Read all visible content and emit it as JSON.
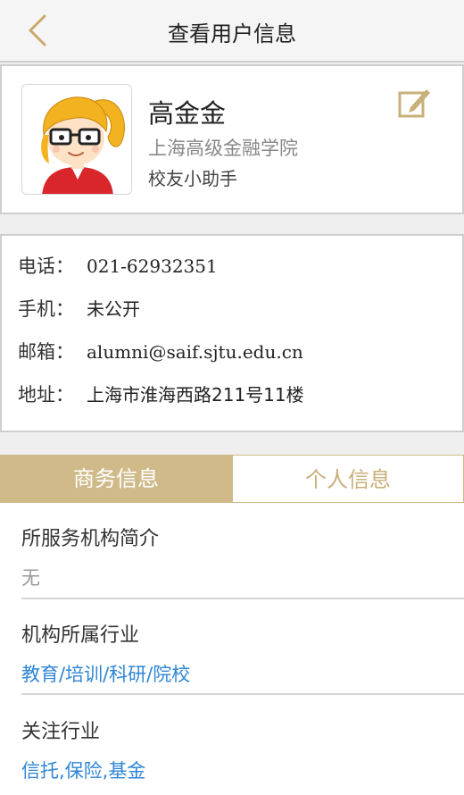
{
  "nav": {
    "title": "查看用户信息"
  },
  "profile": {
    "name": "高金金",
    "school": "上海高级金融学院",
    "role": "校友小助手"
  },
  "contact": {
    "phone_label": "电话：",
    "phone_value": "021-62932351",
    "mobile_label": "手机：",
    "mobile_value": "未公开",
    "email_label": "邮箱：",
    "email_value": "alumni@saif.sjtu.edu.cn",
    "address_label": "地址：",
    "address_value": "上海市淮海西路211号11楼"
  },
  "tabs": {
    "business": "商务信息",
    "personal": "个人信息",
    "active": "business"
  },
  "business": {
    "org_intro_title": "所服务机构简介",
    "org_intro_value": "无",
    "industry_title": "机构所属行业",
    "industry_value": "教育/培训/科研/院校",
    "follow_title": "关注行业",
    "follow_value": "信托,保险,基金"
  },
  "colors": {
    "accent": "#d0ba8a",
    "link": "#2f86d6",
    "back_arrow": "#c8a96a"
  }
}
